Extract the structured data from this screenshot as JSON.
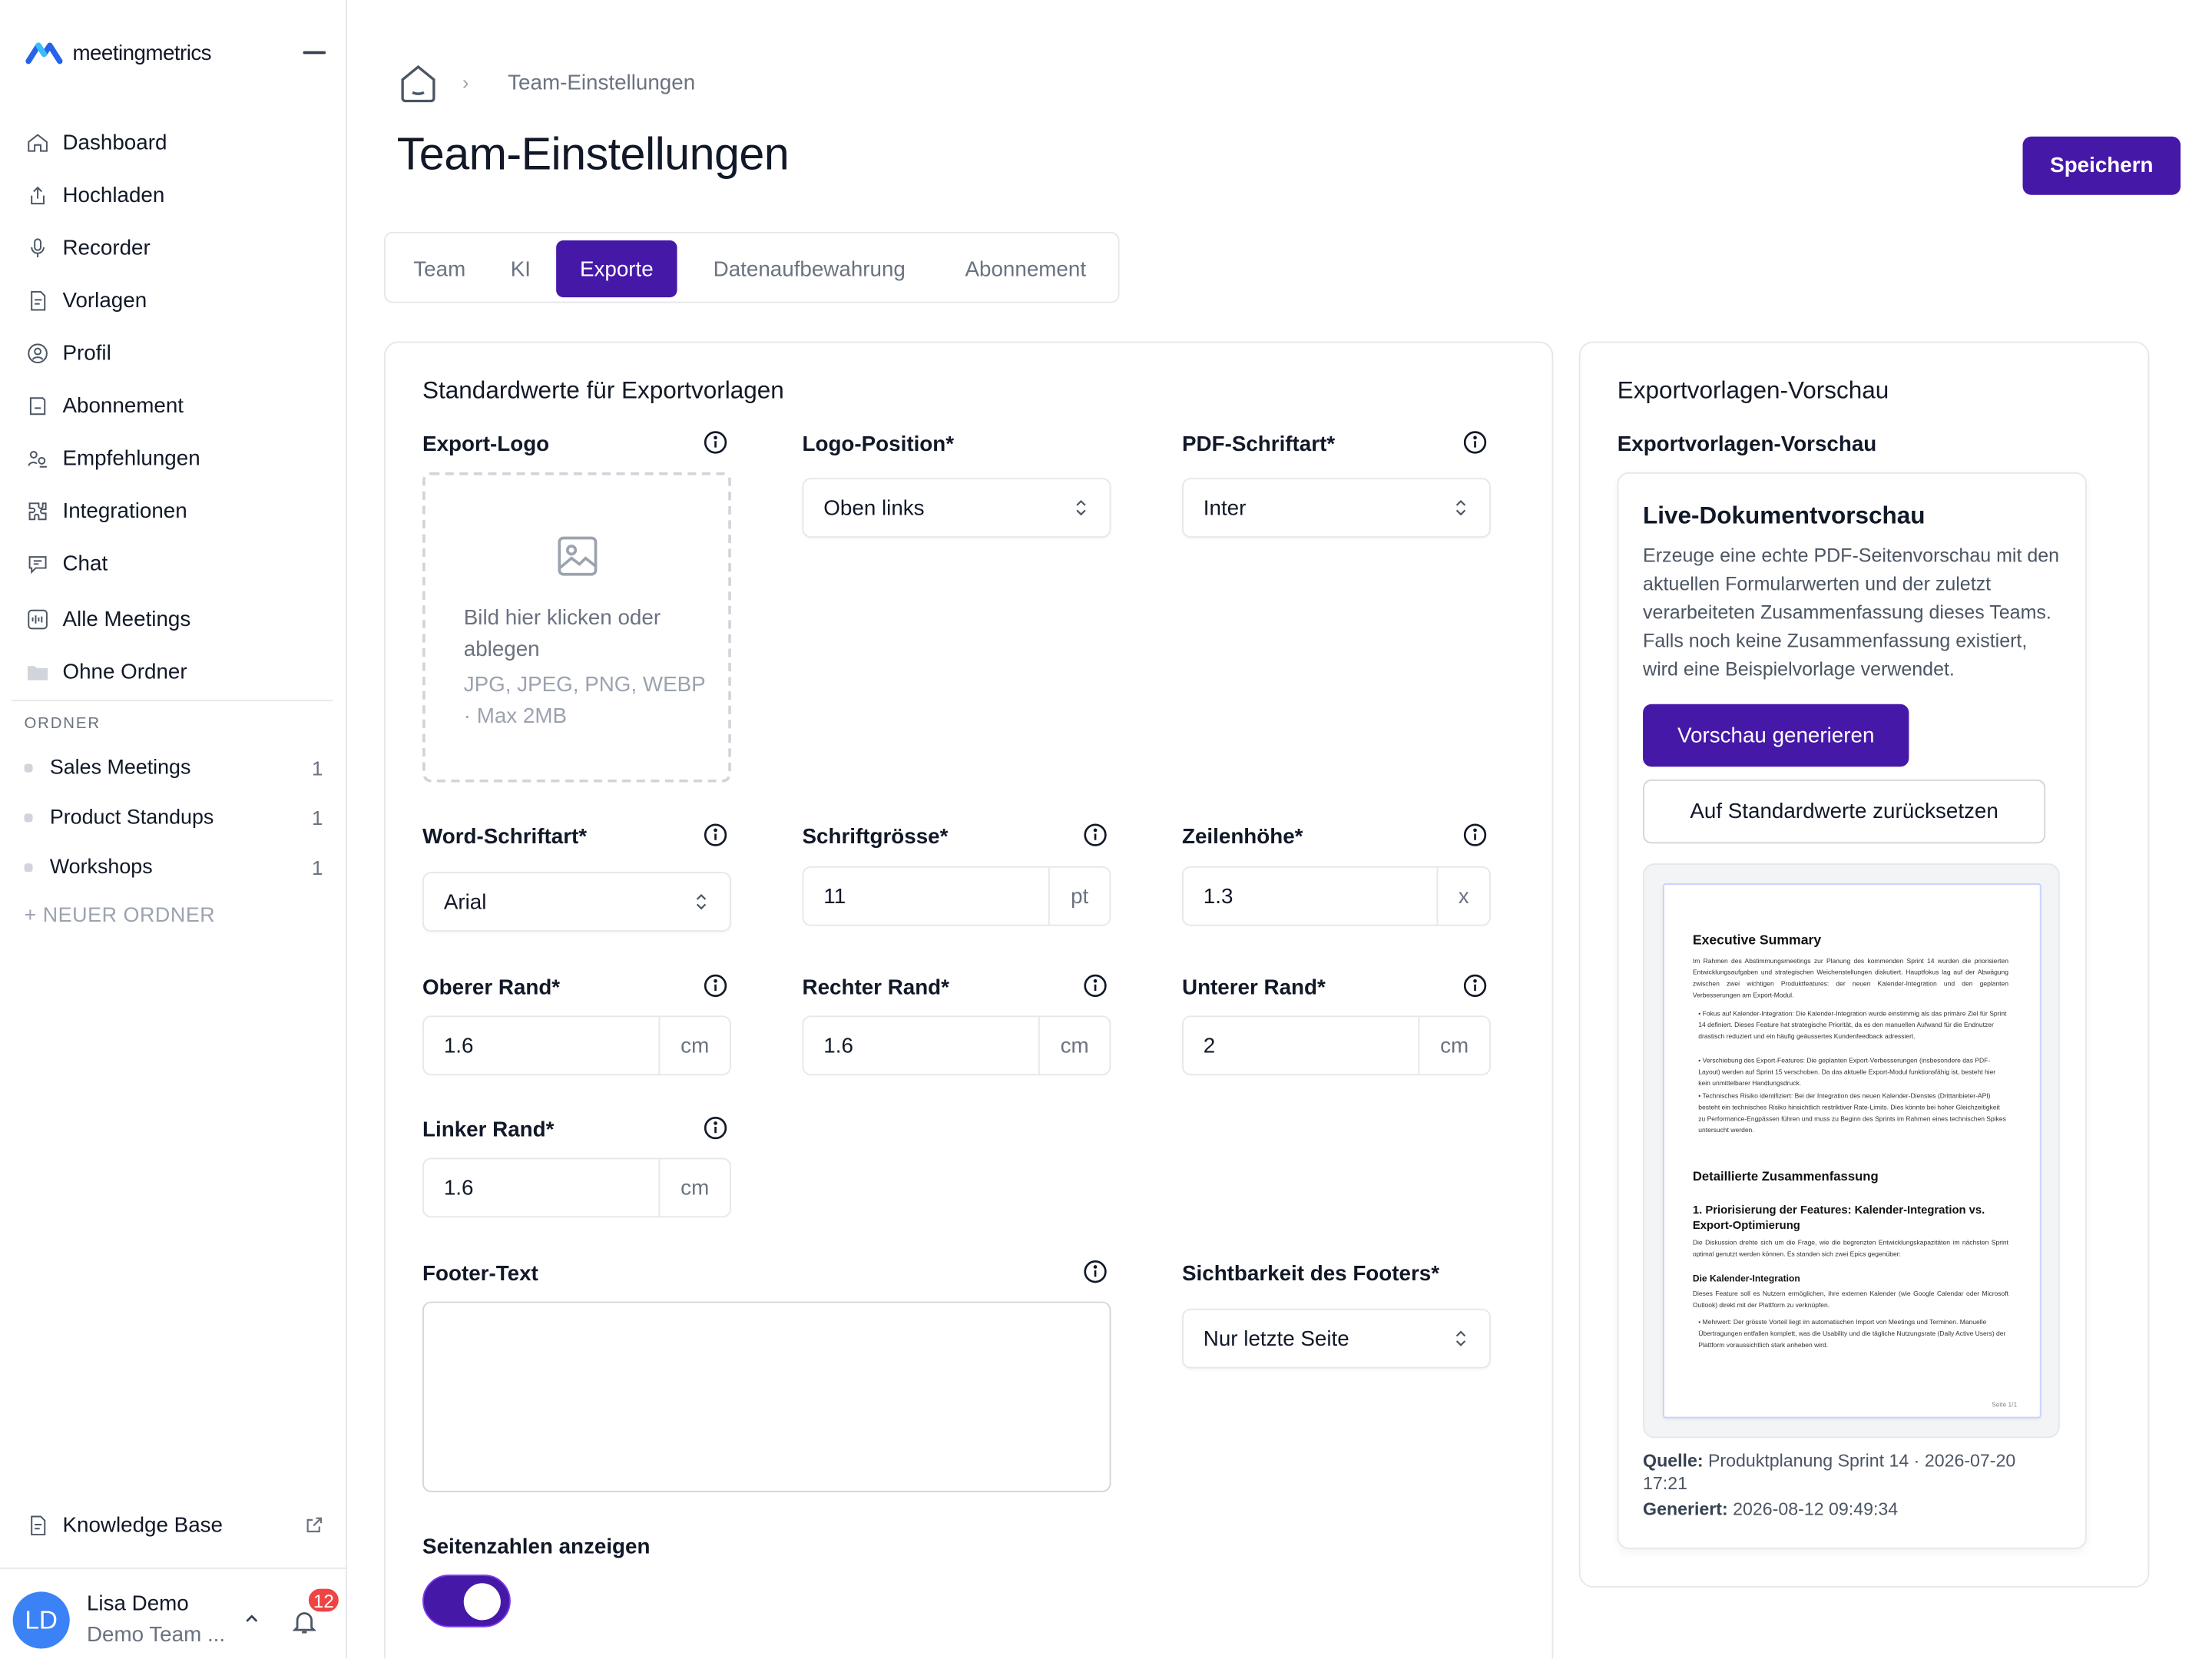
{
  "app": {
    "brand_a": "meeting",
    "brand_b": "metrics"
  },
  "sidebar": {
    "items": [
      {
        "label": "Dashboard",
        "icon": "home-icon"
      },
      {
        "label": "Hochladen",
        "icon": "upload-icon"
      },
      {
        "label": "Recorder",
        "icon": "microphone-icon"
      },
      {
        "label": "Vorlagen",
        "icon": "template-icon"
      },
      {
        "label": "Profil",
        "icon": "profile-icon"
      },
      {
        "label": "Abonnement",
        "icon": "subscription-icon"
      },
      {
        "label": "Empfehlungen",
        "icon": "referral-icon"
      },
      {
        "label": "Integrationen",
        "icon": "integrations-icon"
      },
      {
        "label": "Chat",
        "icon": "chat-icon"
      },
      {
        "label": "Alle Meetings",
        "icon": "waveform-icon"
      },
      {
        "label": "Ohne Ordner",
        "icon": "folder-icon"
      }
    ],
    "folders_label": "ORDNER",
    "folders": [
      {
        "label": "Sales Meetings",
        "count": "1"
      },
      {
        "label": "Product Standups",
        "count": "1"
      },
      {
        "label": "Workshops",
        "count": "1"
      }
    ],
    "new_folder": "+ NEUER ORDNER",
    "knowledge_base": "Knowledge Base",
    "user": {
      "initials": "LD",
      "name": "Lisa Demo",
      "team": "Demo Team ...",
      "notifications": "12"
    }
  },
  "header": {
    "breadcrumb": "Team-Einstellungen",
    "title": "Team-Einstellungen",
    "save_label": "Speichern"
  },
  "tabs": [
    {
      "label": "Team"
    },
    {
      "label": "KI"
    },
    {
      "label": "Exporte",
      "active": true
    },
    {
      "label": "Datenaufbewahrung"
    },
    {
      "label": "Abonnement"
    }
  ],
  "form": {
    "title": "Standardwerte für Exportvorlagen",
    "export_logo": {
      "label": "Export-Logo",
      "drop_text": "Bild hier klicken oder ablegen",
      "drop_hint": "JPG, JPEG, PNG, WEBP · Max 2MB"
    },
    "logo_position": {
      "label": "Logo-Position*",
      "value": "Oben links"
    },
    "pdf_font": {
      "label": "PDF-Schriftart*",
      "value": "Inter"
    },
    "word_font": {
      "label": "Word-Schriftart*",
      "value": "Arial"
    },
    "font_size": {
      "label": "Schriftgrösse*",
      "value": "11",
      "unit": "pt"
    },
    "line_height": {
      "label": "Zeilenhöhe*",
      "value": "1.3",
      "unit": "x"
    },
    "margin_top": {
      "label": "Oberer Rand*",
      "value": "1.6",
      "unit": "cm"
    },
    "margin_right": {
      "label": "Rechter Rand*",
      "value": "1.6",
      "unit": "cm"
    },
    "margin_bottom": {
      "label": "Unterer Rand*",
      "value": "2",
      "unit": "cm"
    },
    "margin_left": {
      "label": "Linker Rand*",
      "value": "1.6",
      "unit": "cm"
    },
    "footer_text": {
      "label": "Footer-Text",
      "value": ""
    },
    "footer_visibility": {
      "label": "Sichtbarkeit des Footers*",
      "value": "Nur letzte Seite"
    },
    "page_numbers": {
      "label": "Seitenzahlen anzeigen",
      "enabled": true
    }
  },
  "preview": {
    "card_title": "Exportvorlagen-Vorschau",
    "section_label": "Exportvorlagen-Vorschau",
    "live_title": "Live-Dokumentvorschau",
    "description": "Erzeuge eine echte PDF-Seitenvorschau mit den aktuellen Formularwerten und der zuletzt verarbeiteten Zusammenfassung dieses Teams. Falls noch keine Zusammenfassung existiert, wird eine Beispielvorlage verwendet.",
    "generate_label": "Vorschau generieren",
    "reset_label": "Auf Standardwerte zurücksetzen",
    "doc": {
      "h1": "Executive Summary",
      "p1": "Im Rahmen des Abstimmungsmeetings zur Planung des kommenden Sprint 14 wurden die priorisierten Entwicklungsaufgaben und strategischen Weichenstellungen diskutiert. Hauptfokus lag auf der Abwägung zwischen zwei wichtigen Produktfeatures: der neuen Kalender-Integration und den geplanten Verbesserungen am Export-Modul.",
      "b1": "• Fokus auf Kalender-Integration: Die Kalender-Integration wurde einstimmig als das primäre Ziel für Sprint 14 definiert. Dieses Feature hat strategische Priorität, da es den manuellen Aufwand für die Endnutzer drastisch reduziert und ein häufig geäussertes Kundenfeedback adressiert.",
      "b2": "• Verschiebung des Export-Features: Die geplanten Export-Verbesserungen (insbesondere das PDF-Layout) werden auf Sprint 15 verschoben. Da das aktuelle Export-Modul funktionsfähig ist, besteht hier kein unmittelbarer Handlungsdruck.",
      "b3": "• Technisches Risiko identifiziert: Bei der Integration des neuen Kalender-Dienstes (Drittanbieter-API) besteht ein technisches Risiko hinsichtlich restriktiver Rate-Limits. Dies könnte bei hoher Gleichzeitigkeit zu Performance-Engpässen führen und muss zu Beginn des Sprints im Rahmen eines technischen Spikes untersucht werden.",
      "h2": "Detaillierte Zusammenfassung",
      "h3": "1. Priorisierung der Features: Kalender-Integration vs. Export-Optimierung",
      "p2": "Die Diskussion drehte sich um die Frage, wie die begrenzten Entwicklungskapazitäten im nächsten Sprint optimal genutzt werden können. Es standen sich zwei Epics gegenüber:",
      "h4": "Die Kalender-Integration",
      "p3": "Dieses Feature soll es Nutzern ermöglichen, ihre externen Kalender (wie Google Calendar oder Microsoft Outlook) direkt mit der Plattform zu verknüpfen.",
      "b4": "• Mehrwert: Der grösste Vorteil liegt im automatischen Import von Meetings und Terminen. Manuelle Übertragungen entfallen komplett, was die Usability und die tägliche Nutzungsrate (Daily Active Users) der Plattform voraussichtlich stark anheben wird.",
      "page": "Seite 1/1"
    },
    "source_label": "Quelle:",
    "source_value": "Produktplanung Sprint 14 · 2026-07-20 17:21",
    "generated_label": "Generiert:",
    "generated_value": "2026-08-12 09:49:34"
  }
}
